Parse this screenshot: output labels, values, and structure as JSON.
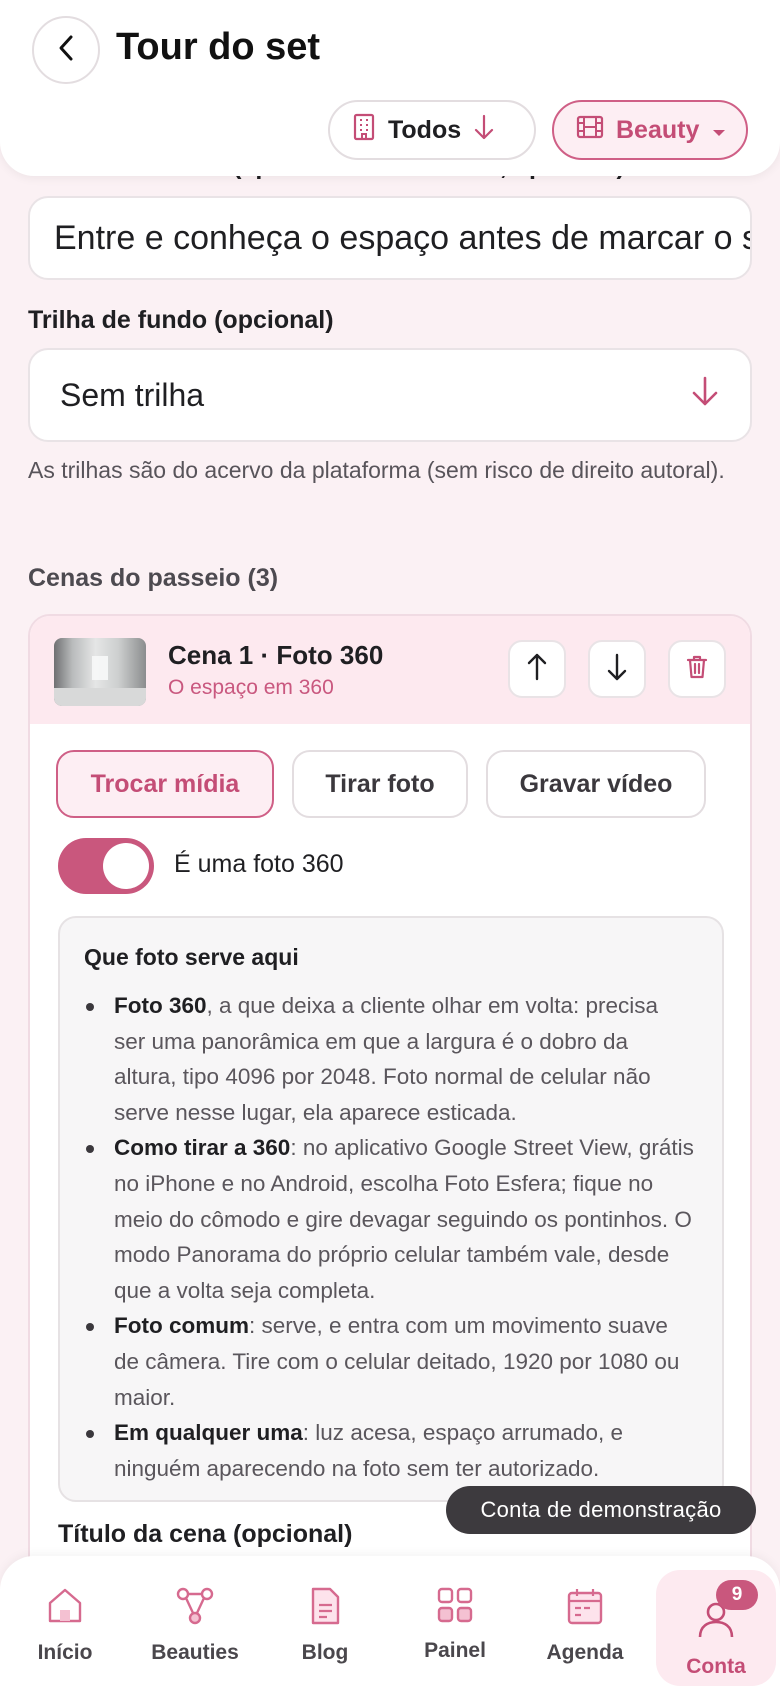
{
  "header": {
    "title": "Tour do set",
    "filter_all": "Todos",
    "filter_category": "Beauty"
  },
  "form": {
    "clipped_label": "Texto de entrada (aparece antes do tour, opcional)",
    "description_value": "Entre e conheça o espaço antes de marcar o seu horário",
    "track_label": "Trilha de fundo (opcional)",
    "track_value": "Sem trilha",
    "track_hint": "As trilhas são do acervo da plataforma (sem risco de direito autoral).",
    "scenes_title": "Cenas do passeio (3)"
  },
  "scene": {
    "title": "Cena 1 · Foto 360",
    "subtitle": "O espaço em 360",
    "btn_replace": "Trocar mídia",
    "btn_photo": "Tirar foto",
    "btn_video": "Gravar vídeo",
    "toggle_label": "É uma foto 360",
    "toggle_on": true,
    "info_title": "Que foto serve aqui",
    "tips": [
      {
        "bold": "Foto 360",
        "text": ", a que deixa a cliente olhar em volta: precisa ser uma panorâmica em que a largura é o dobro da altura, tipo 4096 por 2048. Foto normal de celular não serve nesse lugar, ela aparece esticada."
      },
      {
        "bold": "Como tirar a 360",
        "text": ": no aplicativo Google Street View, grátis no iPhone e no Android, escolha Foto Esfera; fique no meio do cômodo e gire devagar seguindo os pontinhos. O modo Panorama do próprio celular também vale, desde que a volta seja completa."
      },
      {
        "bold": "Foto comum",
        "text": ": serve, e entra com um movimento suave de câmera. Tire com o celular deitado, 1920 por 1080 ou maior."
      },
      {
        "bold": "Em qualquer uma",
        "text": ": luz acesa, espaço arrumado, e ninguém aparecendo na foto sem ter autorizado."
      }
    ],
    "scene_title_label": "Título da cena (opcional)"
  },
  "toast": "Conta de demonstração",
  "nav": [
    {
      "label": "Início",
      "icon": "home-icon"
    },
    {
      "label": "Beauties",
      "icon": "network-icon"
    },
    {
      "label": "Blog",
      "icon": "document-icon"
    },
    {
      "label": "Painel",
      "icon": "grid-icon"
    },
    {
      "label": "Agenda",
      "icon": "calendar-icon"
    },
    {
      "label": "Conta",
      "icon": "user-icon",
      "badge": "9",
      "active": true
    }
  ],
  "colors": {
    "accent": "#c9577d",
    "accent_light": "#fdeef3",
    "background": "#fbf1f4"
  }
}
